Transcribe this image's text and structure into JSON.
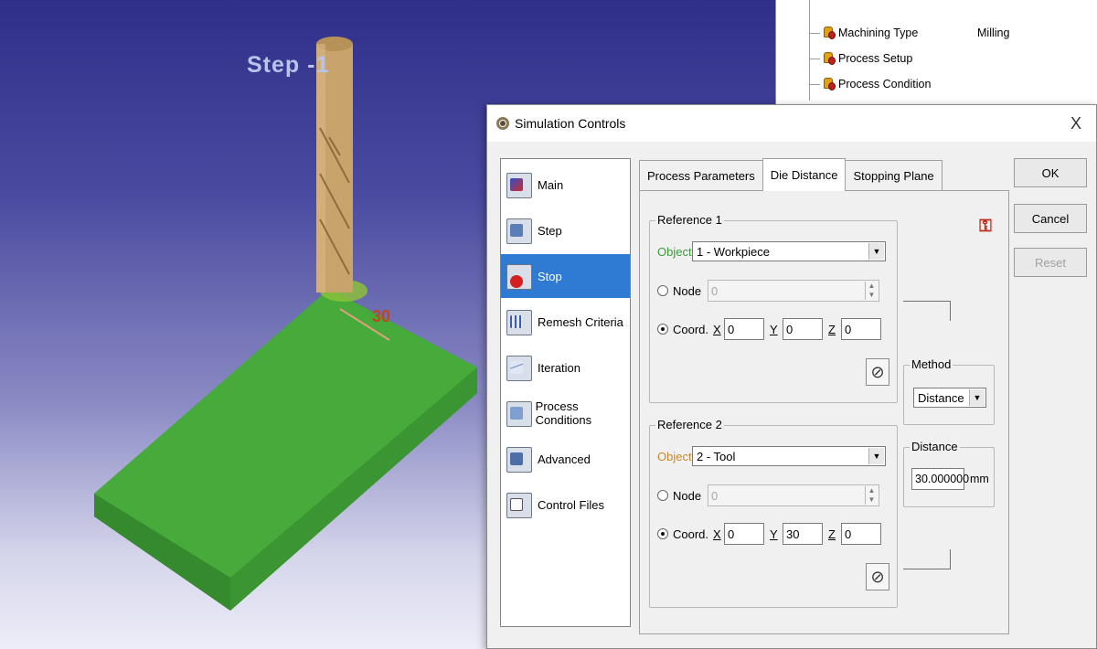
{
  "viewport": {
    "step_label": "Step  -1",
    "dimension_label": "30"
  },
  "tree": {
    "items": [
      {
        "label": "Machining Type",
        "value": "Milling"
      },
      {
        "label": "Process Setup",
        "value": ""
      },
      {
        "label": "Process Condition",
        "value": ""
      }
    ]
  },
  "dialog": {
    "title": "Simulation Controls",
    "close_glyph": "X",
    "nav_items": [
      {
        "label": "Main",
        "icon": "main-icon"
      },
      {
        "label": "Step",
        "icon": "step-icon"
      },
      {
        "label": "Stop",
        "icon": "stop-icon",
        "selected": true
      },
      {
        "label": "Remesh Criteria",
        "icon": "remesh-icon"
      },
      {
        "label": "Iteration",
        "icon": "iteration-icon"
      },
      {
        "label": "Process Conditions",
        "icon": "process-conditions-icon"
      },
      {
        "label": "Advanced",
        "icon": "advanced-icon"
      },
      {
        "label": "Control Files",
        "icon": "control-files-icon"
      }
    ],
    "tabs": [
      "Process Parameters",
      "Die Distance",
      "Stopping Plane"
    ],
    "active_tab": "Die Distance",
    "reference1": {
      "legend": "Reference 1",
      "object_label": "Object",
      "object_value": "1  - Workpiece",
      "node_label": "Node",
      "node_value": "0",
      "coord_label": "Coord.",
      "x_label": "X",
      "x_value": "0",
      "y_label": "Y",
      "y_value": "0",
      "z_label": "Z",
      "z_value": "0"
    },
    "reference2": {
      "legend": "Reference 2",
      "object_label": "Object",
      "object_value": "2  - Tool",
      "node_label": "Node",
      "node_value": "0",
      "coord_label": "Coord.",
      "x_label": "X",
      "x_value": "0",
      "y_label": "Y",
      "y_value": "30",
      "z_label": "Z",
      "z_value": "0"
    },
    "method": {
      "legend": "Method",
      "value": "Distance"
    },
    "distance": {
      "legend": "Distance",
      "value": "30.000000",
      "unit": "mm"
    },
    "buttons": {
      "ok": "OK",
      "cancel": "Cancel",
      "reset": "Reset"
    }
  }
}
